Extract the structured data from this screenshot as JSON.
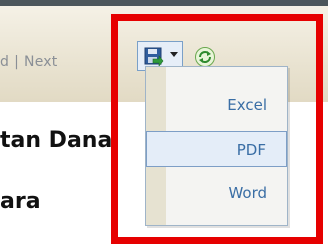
{
  "pager": {
    "prefix": "d",
    "separator": "|",
    "next_label": "Next"
  },
  "toolbar": {
    "export_icon": "save-disk-icon",
    "refresh_icon": "refresh-icon"
  },
  "export_menu": {
    "items": [
      {
        "label": "Excel"
      },
      {
        "label": "PDF",
        "state": "hovered"
      },
      {
        "label": "Word"
      }
    ]
  },
  "report": {
    "title_line_1": "tan Dana",
    "title_line_2": "ara"
  },
  "colors": {
    "highlight": "#e60000",
    "menu_text": "#3a6ea5",
    "hover_bg": "#e4edf8"
  }
}
